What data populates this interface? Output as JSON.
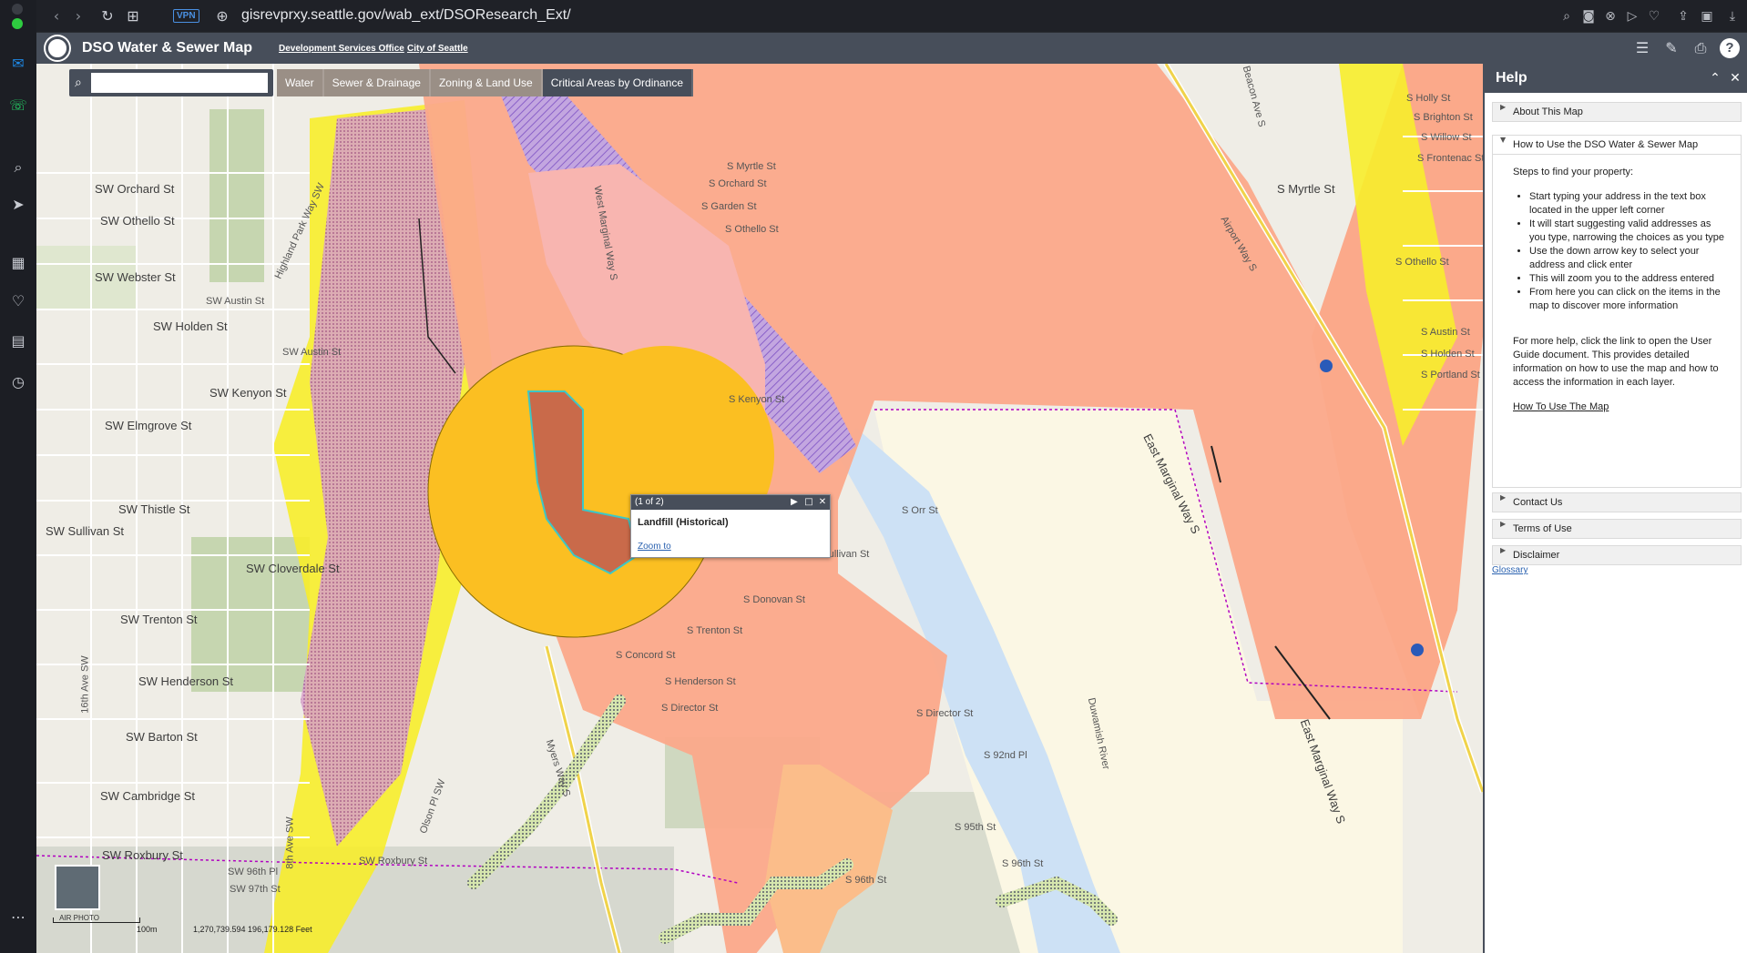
{
  "browser": {
    "url": "gisrevprxy.seattle.gov/wab_ext/DSOResearch_Ext/",
    "vpn_label": "VPN"
  },
  "app": {
    "title": "DSO Water & Sewer Map",
    "links": [
      "Development Services Office",
      "City of Seattle"
    ]
  },
  "search": {
    "placeholder": ""
  },
  "layer_tabs": [
    "Water",
    "Sewer & Drainage",
    "Zoning & Land Use",
    "Critical Areas by Ordinance"
  ],
  "popup": {
    "counter": "(1 of 2)",
    "title": "Landfill (Historical)",
    "zoom_link": "Zoom to"
  },
  "map": {
    "streets": [
      "SW Orchard St",
      "SW Othello St",
      "SW Webster St",
      "SW Austin St",
      "SW Holden St",
      "SW Kenyon St",
      "SW Elmgrove St",
      "SW Thistle St",
      "SW Sullivan St",
      "SW Cloverdale St",
      "SW Trenton St",
      "SW Henderson St",
      "SW Barton St",
      "SW Cambridge St",
      "SW Roxbury St",
      "SW Roxbury St",
      "SW 96th Pl",
      "SW 97th St",
      "S Holly St",
      "S Brighton St",
      "S Willow St",
      "S Frontenac St",
      "S Myrtle St",
      "S Othello St",
      "S Austin St",
      "S Holden St",
      "S Portland St",
      "S Orchard St",
      "S Garden St",
      "S Myrtle St",
      "S Othello St",
      "S Kenyon St",
      "S Trenton St",
      "S Henderson St",
      "S Director St",
      "S Concord St",
      "S Donovan St",
      "S Sullivan St",
      "S Orr St",
      "S 92nd Pl",
      "S 95th St",
      "S 96th St",
      "S 96th St",
      "S Director St",
      "East Marginal Way S",
      "East Marginal Way S",
      "Airport Way S",
      "Beacon Ave S",
      "Duwamish River",
      "Olson Pl SW",
      "Myers Way S",
      "8th Ave SW",
      "16th Ave SW",
      "Highland Park Way SW",
      "West Marginal Way S",
      "SW Austin St"
    ],
    "basemap_label": "AIR PHOTO",
    "scale_label": "100m",
    "coords": "1,270,739.594  196,179.128 Feet"
  },
  "help": {
    "title": "Help",
    "sections": [
      "About This Map",
      "How to Use the DSO Water & Sewer Map",
      "Contact Us",
      "Terms of Use",
      "Disclaimer"
    ],
    "intro": "Steps to find your property:",
    "steps": [
      "Start typing your address in the text box located in the upper left corner",
      "It will start suggesting valid addresses as you type, narrowing the choices as you type",
      "Use the down arrow key to select your address and click enter",
      "This will zoom you to the address entered",
      "From here you can click on the items in the map to discover more information"
    ],
    "more": "For more help, click the link to open the User Guide document. This provides detailed information on how to use the map and how to access the information in each layer.",
    "guide_link": "How To Use The Map",
    "glossary": "Glossary"
  }
}
